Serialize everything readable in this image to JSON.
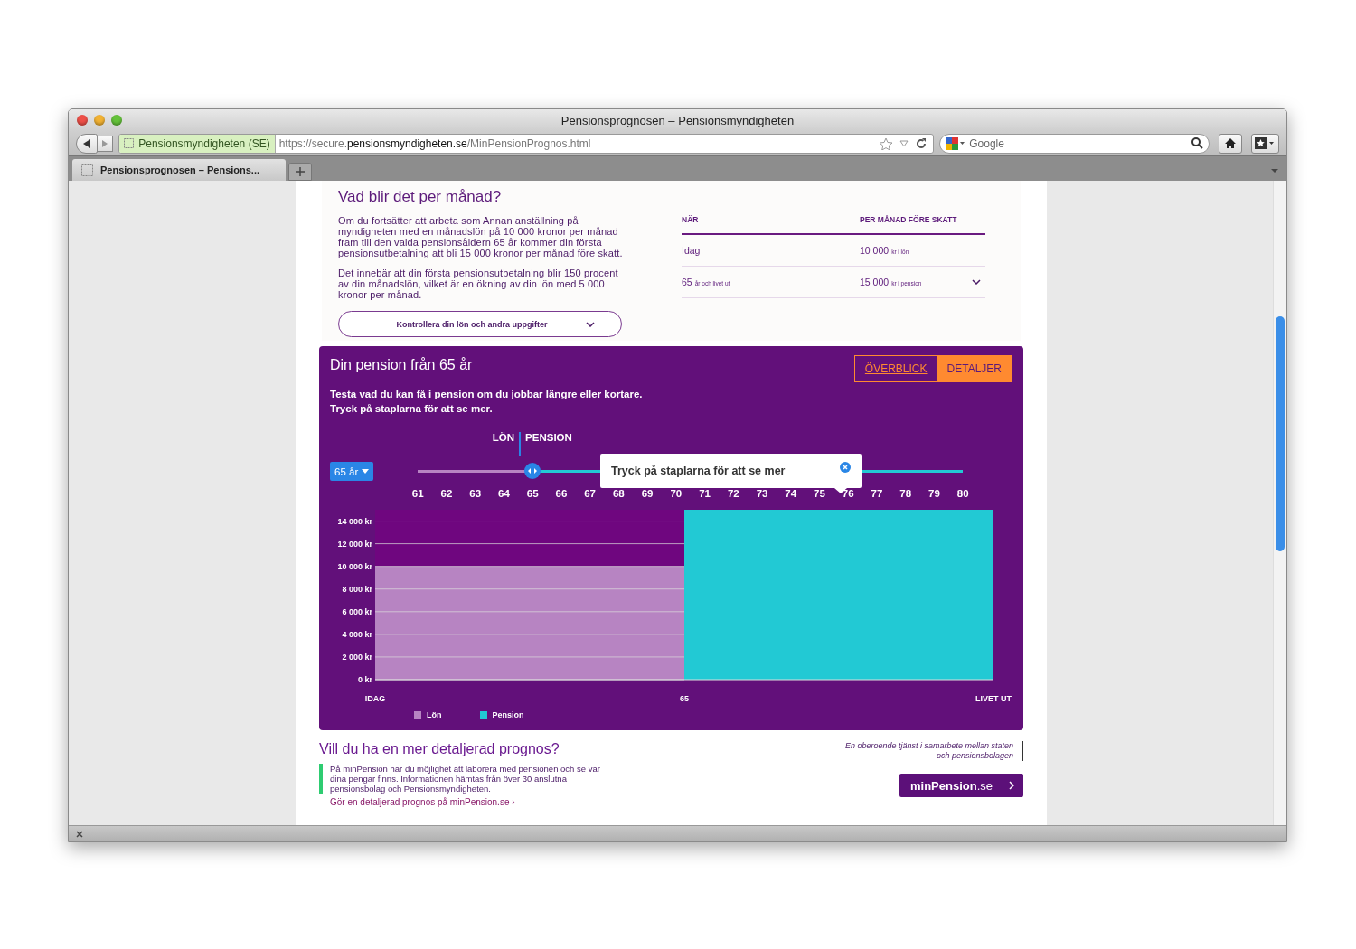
{
  "window": {
    "title": "Pensionsprognosen – Pensionsmyndigheten"
  },
  "toolbar": {
    "identity": "Pensionsmyndigheten (SE)",
    "url": "https://secure.**pensionsmyndigheten.se**/MinPensionPrognos.html",
    "search_placeholder": "Google"
  },
  "tabs": [
    {
      "label": "Pensionsprognosen – Pensions...",
      "selected": true
    }
  ],
  "summary": {
    "heading": "Vad blir det per månad?",
    "paragraphs": [
      "Om du fortsätter att arbeta som Annan anställning på myndigheten med en månadslön på 10 000 kronor per månad fram till den valda pensionsåldern 65 år kommer din första pensionsutbetalning att bli 15 000 kronor per månad före skatt.",
      "Det innebär att din första pensionsutbetalning blir 150 procent av din månadslön, vilket är en ökning av din lön med 5 000 kronor per månad."
    ],
    "check_button": "Kontrollera din lön och andra uppgifter",
    "table": {
      "columns": [
        "NÄR",
        "PER MÅNAD FÖRE SKATT"
      ],
      "rows": [
        {
          "when": "Idag",
          "amount": "10 000",
          "unit": "kr i lön",
          "expandable": false
        },
        {
          "when": "65",
          "when_suffix": "år och livet ut",
          "amount": "15 000",
          "unit": "kr i pension",
          "expandable": true
        }
      ]
    }
  },
  "pension_panel": {
    "title": "Din pension från 65 år",
    "view_tabs": [
      {
        "label": "ÖVERBLICK",
        "selected": false
      },
      {
        "label": "DETALJER",
        "selected": true
      }
    ],
    "intro": [
      "Testa vad du kan få i pension om du jobbar längre eller kortare.",
      "Tryck på staplarna för att se mer."
    ],
    "age_select": "65 år",
    "slider": {
      "left_label": "LÖN",
      "right_label": "PENSION",
      "level": 0.21,
      "ages": [
        "61",
        "62",
        "63",
        "64",
        "65",
        "66",
        "67",
        "68",
        "69",
        "70",
        "71",
        "72",
        "73",
        "74",
        "75",
        "76",
        "77",
        "78",
        "79",
        "80"
      ]
    },
    "tooltip": "Tryck på staplarna för att se mer",
    "chart_data": {
      "type": "bar",
      "categories": [
        "IDAG",
        "65",
        "LIVET UT"
      ],
      "series": [
        {
          "name": "Lön",
          "color": "#b784c2",
          "values": [
            10000,
            null,
            null
          ]
        },
        {
          "name": "Pension",
          "color": "#22c9d4",
          "values": [
            null,
            15000,
            null
          ]
        }
      ],
      "ylim": [
        0,
        15000
      ],
      "yticks": [
        {
          "value": 0,
          "label": "0 kr"
        },
        {
          "value": 2000,
          "label": "2 000 kr"
        },
        {
          "value": 4000,
          "label": "4 000 kr"
        },
        {
          "value": 6000,
          "label": "6 000 kr"
        },
        {
          "value": 8000,
          "label": "8 000 kr"
        },
        {
          "value": 10000,
          "label": "10 000 kr"
        },
        {
          "value": 12000,
          "label": "12 000 kr"
        },
        {
          "value": 14000,
          "label": "14 000 kr"
        }
      ]
    }
  },
  "more": {
    "heading": "Vill du ha en mer detaljerad prognos?",
    "text": "På minPension har du möjlighet att laborera med pensionen och se var dina pengar finns. Informationen hämtas från över 30 anslutna pensionsbolag och Pensionsmyndigheten.",
    "link": "Gör en detaljerad prognos på minPension.se ›",
    "note": "En oberoende tjänst i samarbete mellan staten och pensionsbolagen",
    "logo_main": "minPension",
    "logo_suffix": ".se"
  }
}
